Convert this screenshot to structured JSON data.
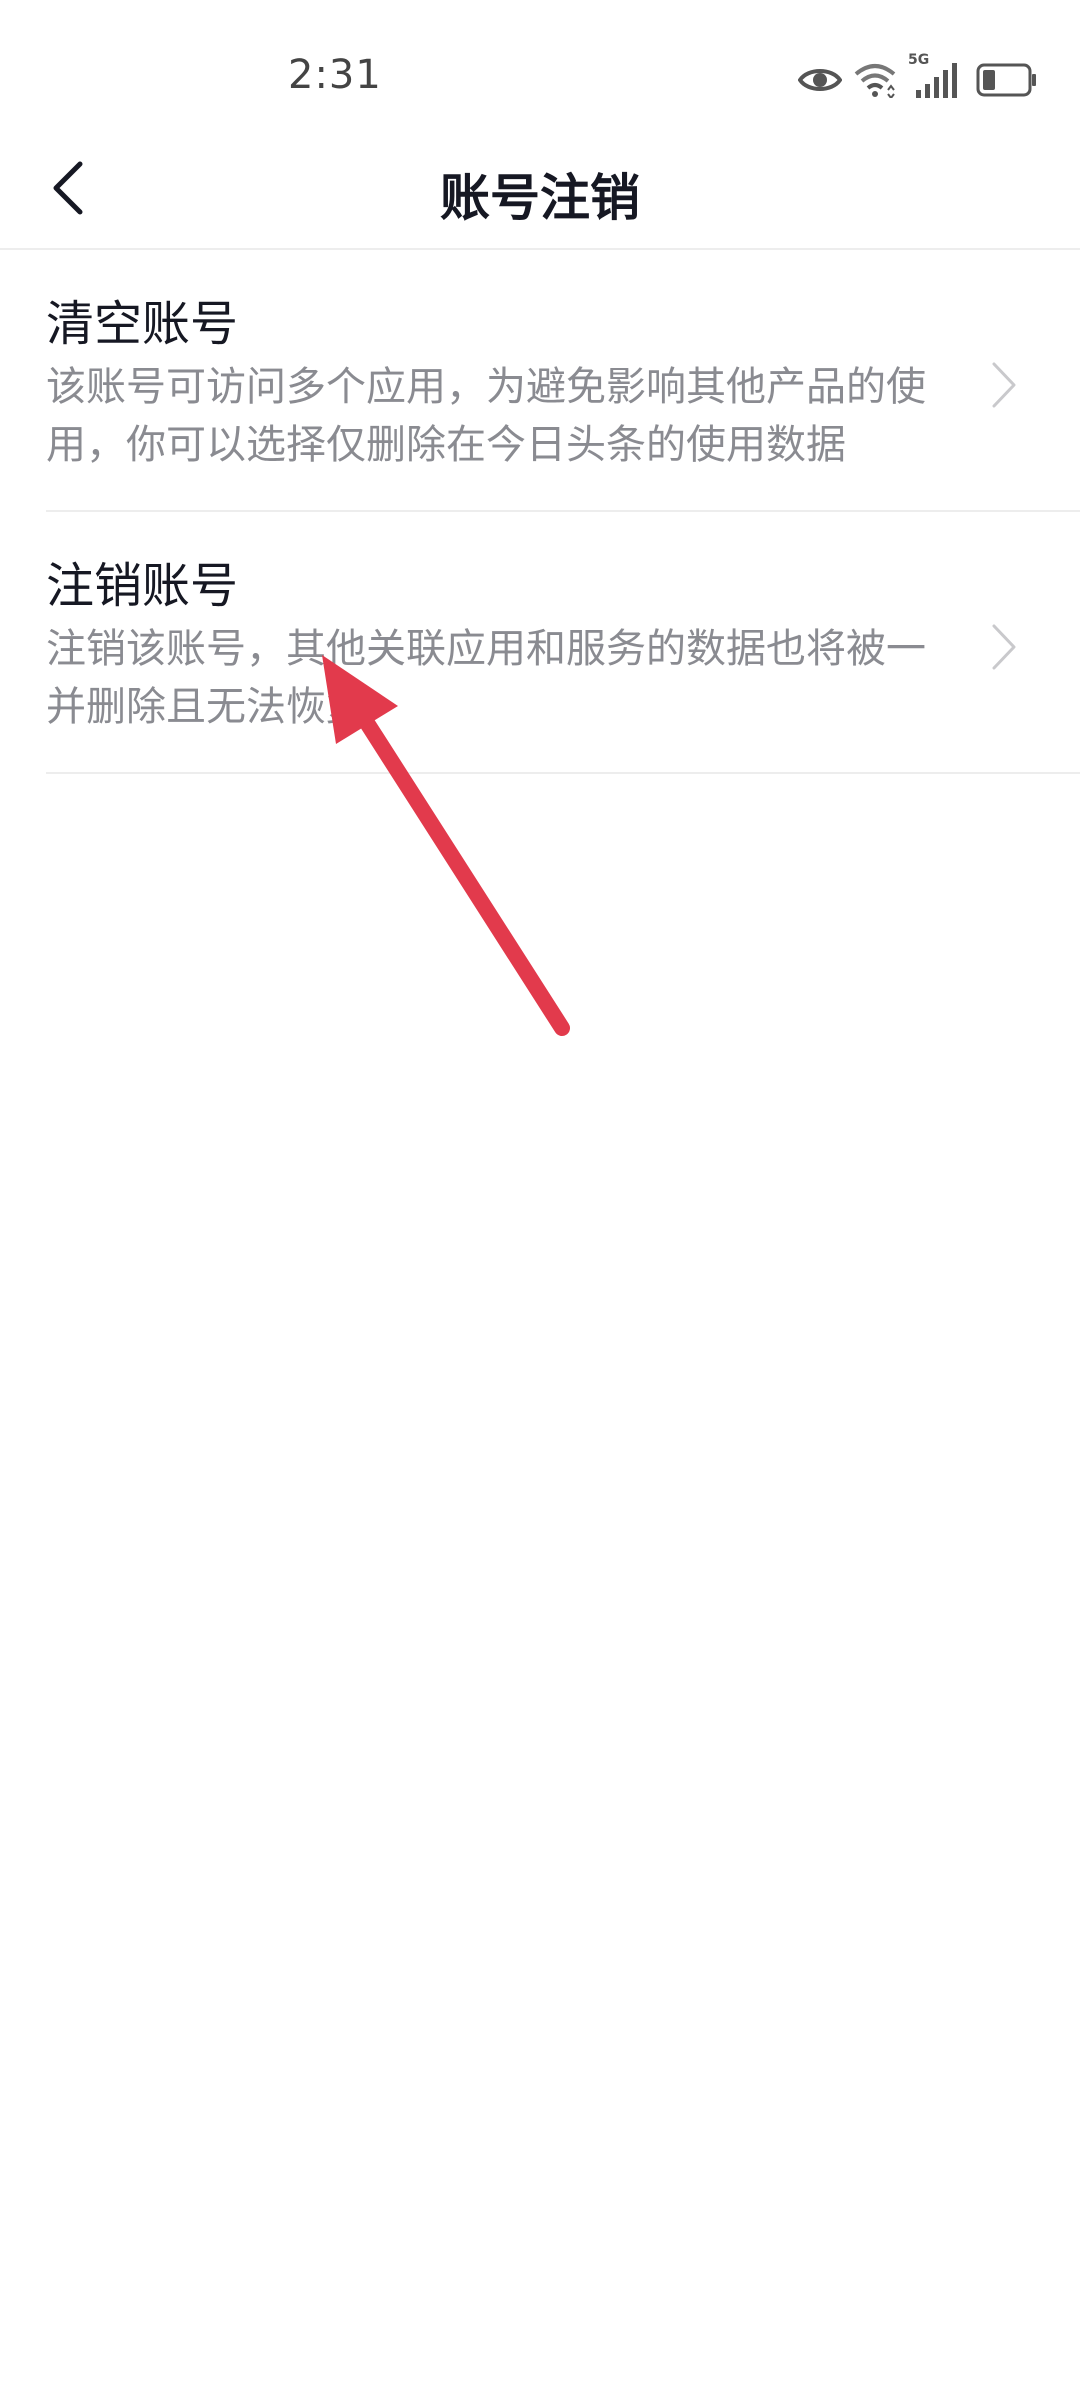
{
  "status_bar": {
    "time": "2:31",
    "network_label": "5G",
    "icons": [
      "eye-icon",
      "wifi-icon",
      "signal-icon",
      "battery-icon"
    ]
  },
  "nav": {
    "title": "账号注销",
    "back_icon": "chevron-left-icon"
  },
  "items": [
    {
      "title": "清空账号",
      "description": "该账号可访问多个应用，为避免影响其他产品的使用，你可以选择仅删除在今日头条的使用数据"
    },
    {
      "title": "注销账号",
      "description": "注销该账号，其他关联应用和服务的数据也将被一并删除且无法恢复"
    }
  ],
  "colors": {
    "title_text": "#161823",
    "secondary_text": "#8a8b91",
    "divider": "#ededed",
    "annotation_arrow": "#e23a4c"
  }
}
